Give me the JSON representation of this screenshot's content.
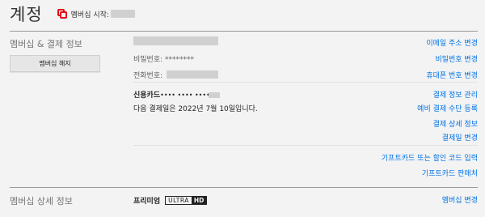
{
  "header": {
    "title": "계정",
    "member_since": "멤버십 시작:"
  },
  "membership": {
    "section_label": "멤버십 & 결제 정보",
    "cancel_button": "멤버십 해지",
    "password_label": "비밀번호:",
    "password_value": "********",
    "phone_label": "전화번호:",
    "card_label": "신용카드",
    "card_mask": "•••• •••• ••••",
    "next_billing": "다음 결제일은 2022년 7월 10일입니다."
  },
  "links": {
    "change_email": "이메일 주소 변경",
    "change_password": "비밀번호 변경",
    "change_phone": "휴대폰 번호 변경",
    "manage_payment": "결제 정보 관리",
    "backup_payment": "예비 결제 수단 등록",
    "billing_details": "결제 상세 정보",
    "change_billing_day": "결제일 변경",
    "redeem_gift": "기프트카드 또는 할인 코드 입력",
    "gift_retailers": "기프트카드 판매처"
  },
  "plan": {
    "section_label": "멤버십 상세 정보",
    "name": "프리미엄",
    "badge_ultra": "ULTRA",
    "badge_hd": "HD",
    "change_plan": "멤버십 변경"
  },
  "colors": {
    "accent_link": "#0073e6",
    "brand_red": "#e50914"
  }
}
